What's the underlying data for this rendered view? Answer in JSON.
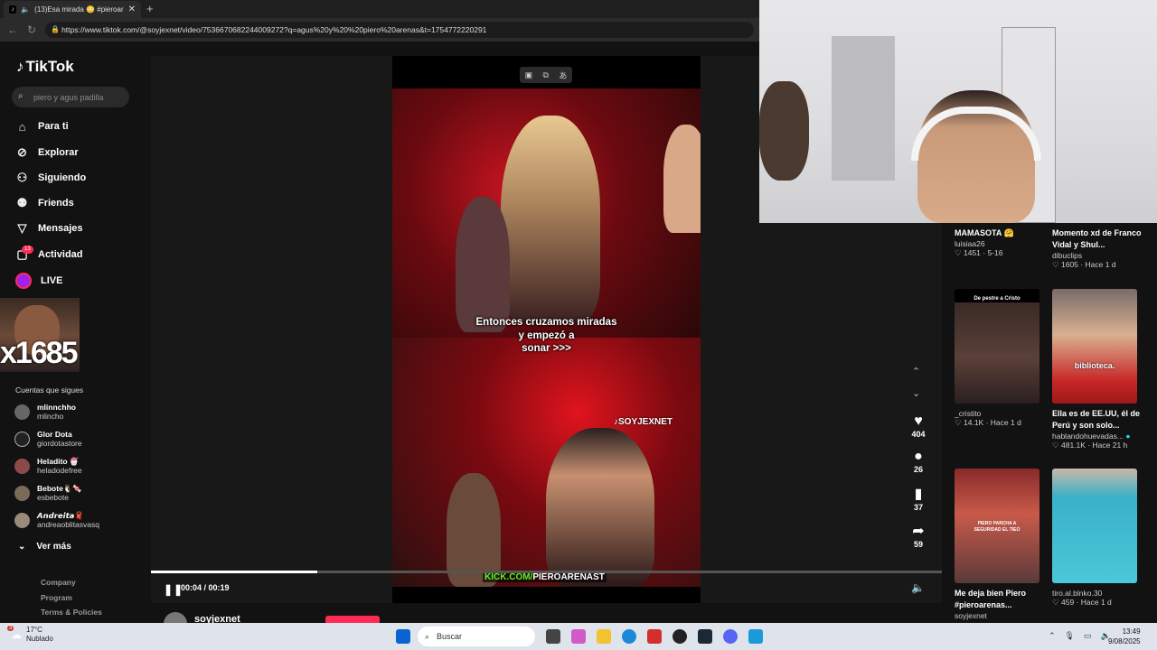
{
  "browser": {
    "tab_title": "(13)Esa mirada 😳 #pieroar",
    "tab_close": "✕",
    "new_tab": "+",
    "url": "https://www.tiktok.com/@soyjexnet/video/7536670682244009272?q=agus%20y%20%20piero%20arenas&t=1754772220291"
  },
  "sidebar": {
    "logo": "TikTok",
    "search_placeholder": "piero y agus padilla",
    "nav": [
      {
        "label": "Para ti",
        "icon": "home-icon"
      },
      {
        "label": "Explorar",
        "icon": "compass-icon"
      },
      {
        "label": "Siguiendo",
        "icon": "following-icon"
      },
      {
        "label": "Friends",
        "icon": "friends-icon"
      },
      {
        "label": "Mensajes",
        "icon": "messages-icon"
      },
      {
        "label": "Actividad",
        "icon": "activity-icon"
      },
      {
        "label": "LIVE",
        "icon": "live-icon"
      }
    ],
    "activity_badge": "13",
    "cam_overlay_text": "x1685",
    "following_title": "Cuentas que sigues",
    "accounts": [
      {
        "name": "mlinnchho",
        "handle": "mlincho"
      },
      {
        "name": "Glor Dota",
        "handle": "giordotastore"
      },
      {
        "name": "Heladito 🍧",
        "handle": "heladodefree"
      },
      {
        "name": "Bebote🐧🍬",
        "handle": "esbebote"
      },
      {
        "name": "𝘼𝙣𝙙𝙧𝙚𝙞𝙩𝙖🧣",
        "handle": "andreaoblitasvasq"
      }
    ],
    "see_more": "Ver más",
    "footer": [
      "Company",
      "Program",
      "Terms & Policies"
    ]
  },
  "player": {
    "caption_lines": [
      "Entonces cruzamos miradas",
      "y empezó a",
      "sonar >>>"
    ],
    "watermark": "SOYJEXNET",
    "kick_prefix": "KICK.COM/",
    "kick_suffix": "PIEROARENAST",
    "time": "00:04 / 00:19",
    "progress_fraction": 0.2105,
    "likes": "404",
    "comments": "26",
    "saves": "37",
    "shares": "59",
    "author": "soyjexnet"
  },
  "feed": {
    "items": [
      {
        "title": "MAMASOTA 🤗",
        "author": "luisiaa26",
        "likes": "1451",
        "date": "5-16"
      },
      {
        "title": "Momento xd de Franco Vidal y Shul...",
        "author": "dibuclips",
        "likes": "1605",
        "date": "Hace 1 d"
      },
      {
        "title": "",
        "author": "_cristito",
        "likes": "14.1K",
        "date": "Hace 1 d",
        "thumb_text": "De pestre a Cristo"
      },
      {
        "title": "Ella es de EE.UU, él de Perú y son solo...",
        "author": "hablandohuevadas...",
        "likes": "481.1K",
        "date": "Hace 21 h",
        "thumb_text": "biblioteca."
      },
      {
        "title": "Me deja bien Piero #pieroarenas...",
        "author": "soyjexnet",
        "likes": "",
        "date": "",
        "thumb_text": "PIERO PARCHA A SEGURIDAD EL TIEO"
      },
      {
        "title": "",
        "author": "tiro.al.blnko.30",
        "likes": "459",
        "date": "Hace 1 d"
      }
    ]
  },
  "taskbar": {
    "temp": "17°C",
    "weather": "Nublado",
    "weather_badge": "3",
    "search": "Buscar",
    "time": "13:49",
    "date": "9/08/2025"
  },
  "colors": {
    "tiktok_red": "#fe2c55",
    "kick_green": "#53fc18"
  }
}
